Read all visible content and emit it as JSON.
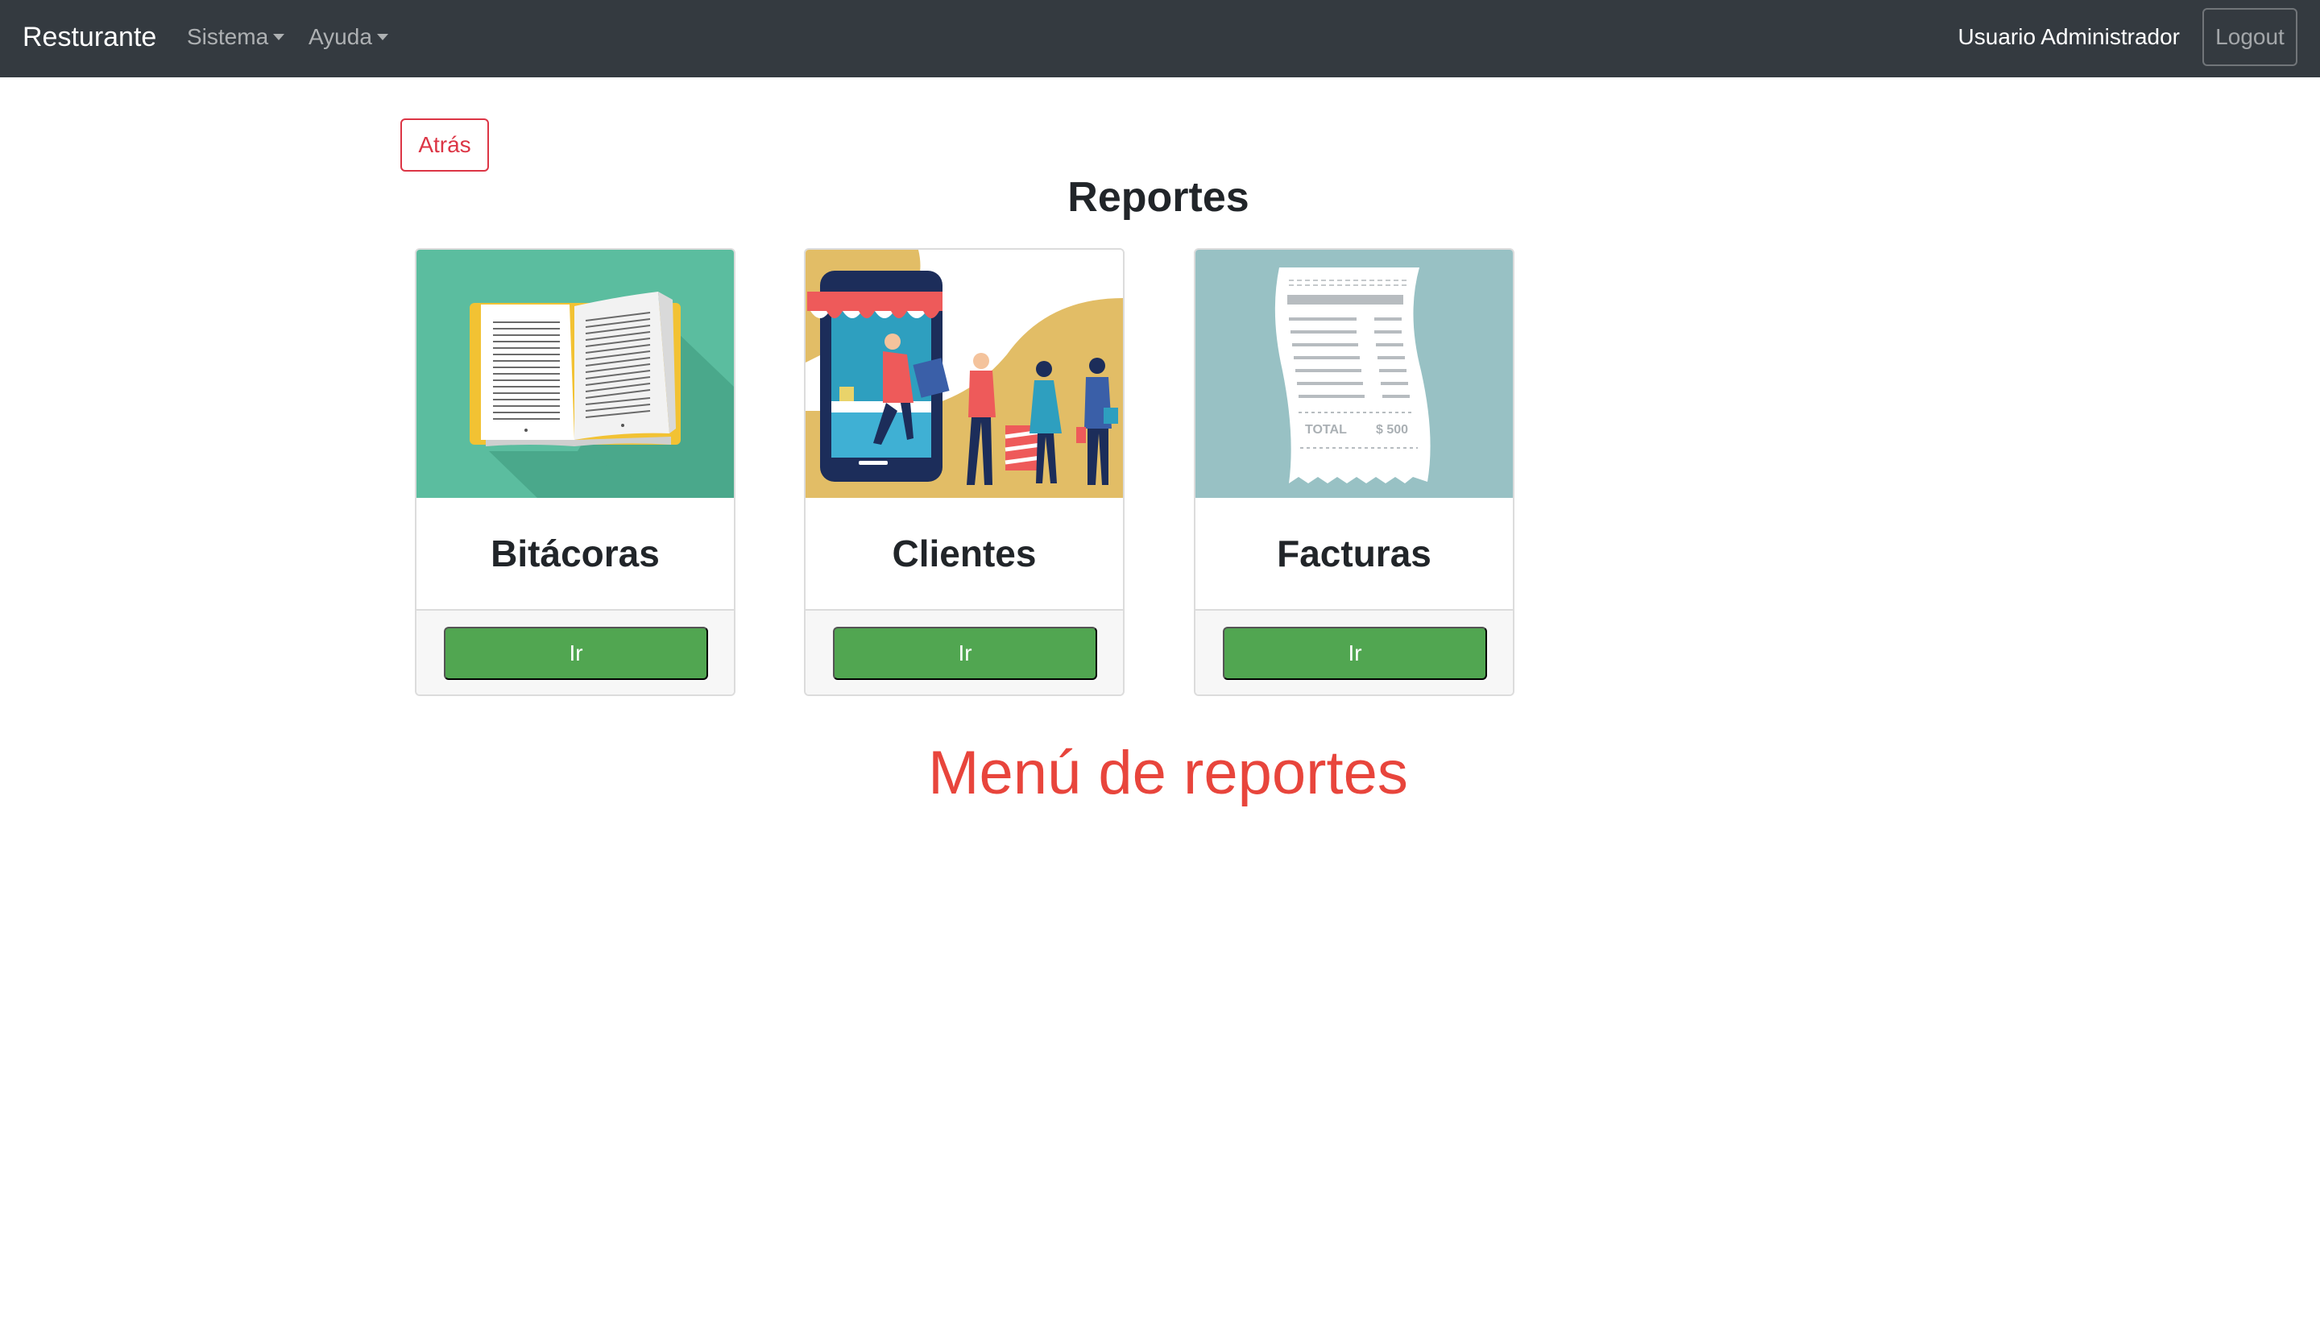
{
  "navbar": {
    "brand": "Resturante",
    "menus": [
      {
        "label": "Sistema"
      },
      {
        "label": "Ayuda"
      }
    ],
    "user_label": "Usuario Administrador",
    "logout_label": "Logout"
  },
  "main": {
    "back_label": "Atrás",
    "title": "Reportes",
    "cards": [
      {
        "title": "Bitácoras",
        "button_label": "Ir",
        "image": "open-book-illustration"
      },
      {
        "title": "Clientes",
        "button_label": "Ir",
        "image": "online-shop-customers-illustration"
      },
      {
        "title": "Facturas",
        "button_label": "Ir",
        "image": "receipt-illustration"
      }
    ],
    "receipt_total_label": "TOTAL",
    "receipt_total_value": "$ 500",
    "caption": "Menú de reportes"
  },
  "colors": {
    "navbar_bg": "#343a40",
    "danger": "#dc3545",
    "success": "#51a651",
    "caption": "#e8453c"
  }
}
